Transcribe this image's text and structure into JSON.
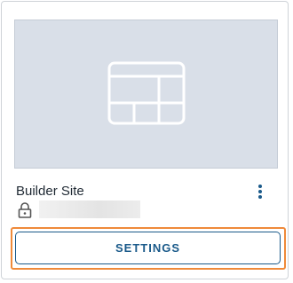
{
  "card": {
    "title": "Builder Site",
    "thumbnail_icon": "layout-template-icon",
    "more_icon": "more-vertical-icon",
    "lock_icon": "lock-icon",
    "settings_label": "SETTINGS"
  },
  "colors": {
    "accent": "#1a5a8a",
    "highlight": "#ef8a3a",
    "thumbnail_bg": "#d9dfe8"
  }
}
